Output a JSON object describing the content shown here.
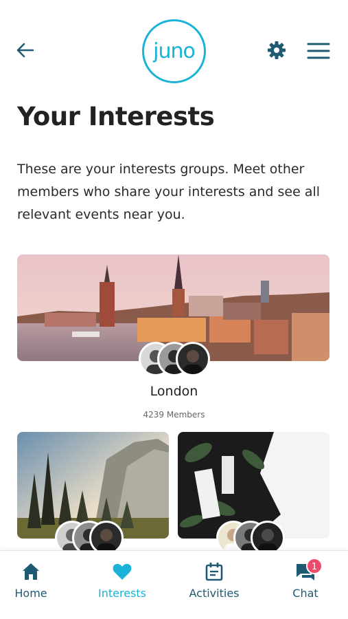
{
  "header": {
    "logo_text": "juno",
    "title": "Your Interests",
    "intro": "These are your interests groups. Meet other members who share your interests and see all relevant events near you."
  },
  "groups": [
    {
      "name": "London",
      "members": "4239 Members"
    }
  ],
  "nav": {
    "home": "Home",
    "interests": "Interests",
    "activities": "Activities",
    "chat": "Chat",
    "chat_badge": "1"
  },
  "colors": {
    "accent": "#1ab2d6",
    "dark_teal": "#1f5a73",
    "badge": "#ef4a6a"
  }
}
